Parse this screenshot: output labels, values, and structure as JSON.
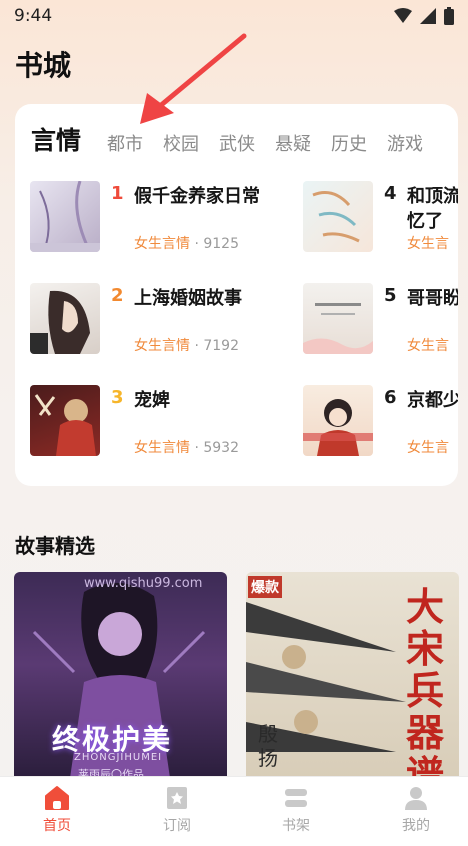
{
  "status": {
    "time": "9:44"
  },
  "header": {
    "title": "书城"
  },
  "rank": {
    "tabs": [
      "言情",
      "都市",
      "校园",
      "武侠",
      "悬疑",
      "历史",
      "游戏"
    ],
    "books": [
      {
        "rank": "1",
        "title": "假千金养家日常",
        "title2": "",
        "category": "女生言情",
        "count": "9125",
        "rank_color": "#ef4b3b"
      },
      {
        "rank": "2",
        "title": "上海婚姻故事",
        "title2": "",
        "category": "女生言情",
        "count": "7192",
        "rank_color": "#f2892f"
      },
      {
        "rank": "3",
        "title": "宠婢",
        "title2": "",
        "category": "女生言情",
        "count": "5932",
        "rank_color": "#f6b52a"
      },
      {
        "rank": "4",
        "title": "和顶流",
        "title2": "忆了",
        "category": "女生言",
        "count": "",
        "rank_color": "#1b1b1b"
      },
      {
        "rank": "5",
        "title": "哥哥盼",
        "title2": "",
        "category": "女生言",
        "count": "",
        "rank_color": "#1b1b1b"
      },
      {
        "rank": "6",
        "title": "京都少",
        "title2": "",
        "category": "女生言",
        "count": "",
        "rank_color": "#1b1b1b"
      }
    ],
    "separator": " · "
  },
  "stories": {
    "title": "故事精选",
    "covers": [
      {
        "text": "终极护美",
        "sub": "ZHONGJIHUMEI",
        "author": "莱雨辰〇作品",
        "url": "www.qishu99.com"
      },
      {
        "text": "大宋兵器谱",
        "sub": "殷扬",
        "badge": "爆款"
      }
    ]
  },
  "nav": {
    "items": [
      {
        "label": "首页",
        "icon": "home-icon"
      },
      {
        "label": "订阅",
        "icon": "bookmark-icon"
      },
      {
        "label": "书架",
        "icon": "bookshelf-icon"
      },
      {
        "label": "我的",
        "icon": "profile-icon"
      }
    ]
  },
  "colors": {
    "accent": "#f04e3a",
    "category": "#f08a3c"
  }
}
